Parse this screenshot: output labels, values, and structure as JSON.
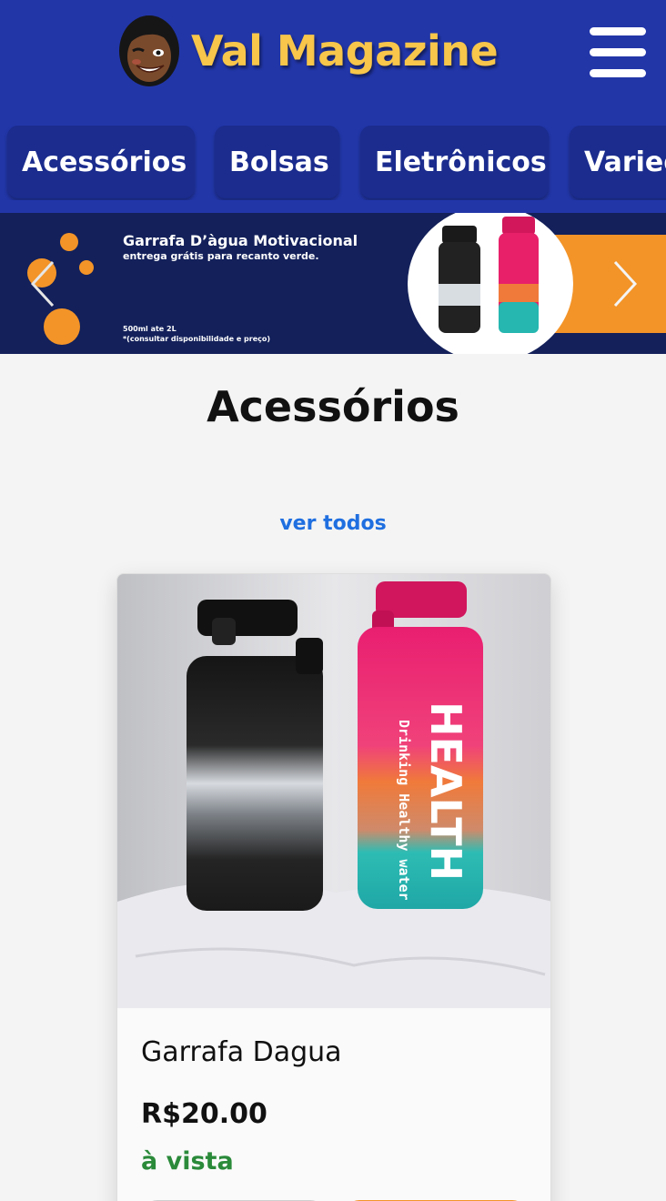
{
  "header": {
    "title": "Val Magazine",
    "avatar_icon": "avatar-face-icon",
    "menu_icon": "hamburger-menu-icon",
    "bg_color": "#2236a8",
    "title_color": "#f7c64a"
  },
  "categories": [
    "Acessórios",
    "Bolsas",
    "Eletrônicos",
    "Variedades"
  ],
  "banner": {
    "title": "Garrafa D’àgua Motivacional",
    "subtitle": "entrega grátis para recanto verde.",
    "note_line1": "500ml ate 2L",
    "note_line2": "*(consultar disponibilidade e preço)",
    "prev_icon": "chevron-left-icon",
    "next_icon": "chevron-right-icon",
    "accent_color": "#f39428"
  },
  "section": {
    "title": "Acessórios",
    "see_all": "ver todos"
  },
  "product": {
    "name": "Garrafa Dagua",
    "price": "R$20.00",
    "payment_terms": "à vista",
    "photo_bottle1_label": "HEALTH",
    "photo_bottle2_label": "Drinking Healthy water"
  }
}
